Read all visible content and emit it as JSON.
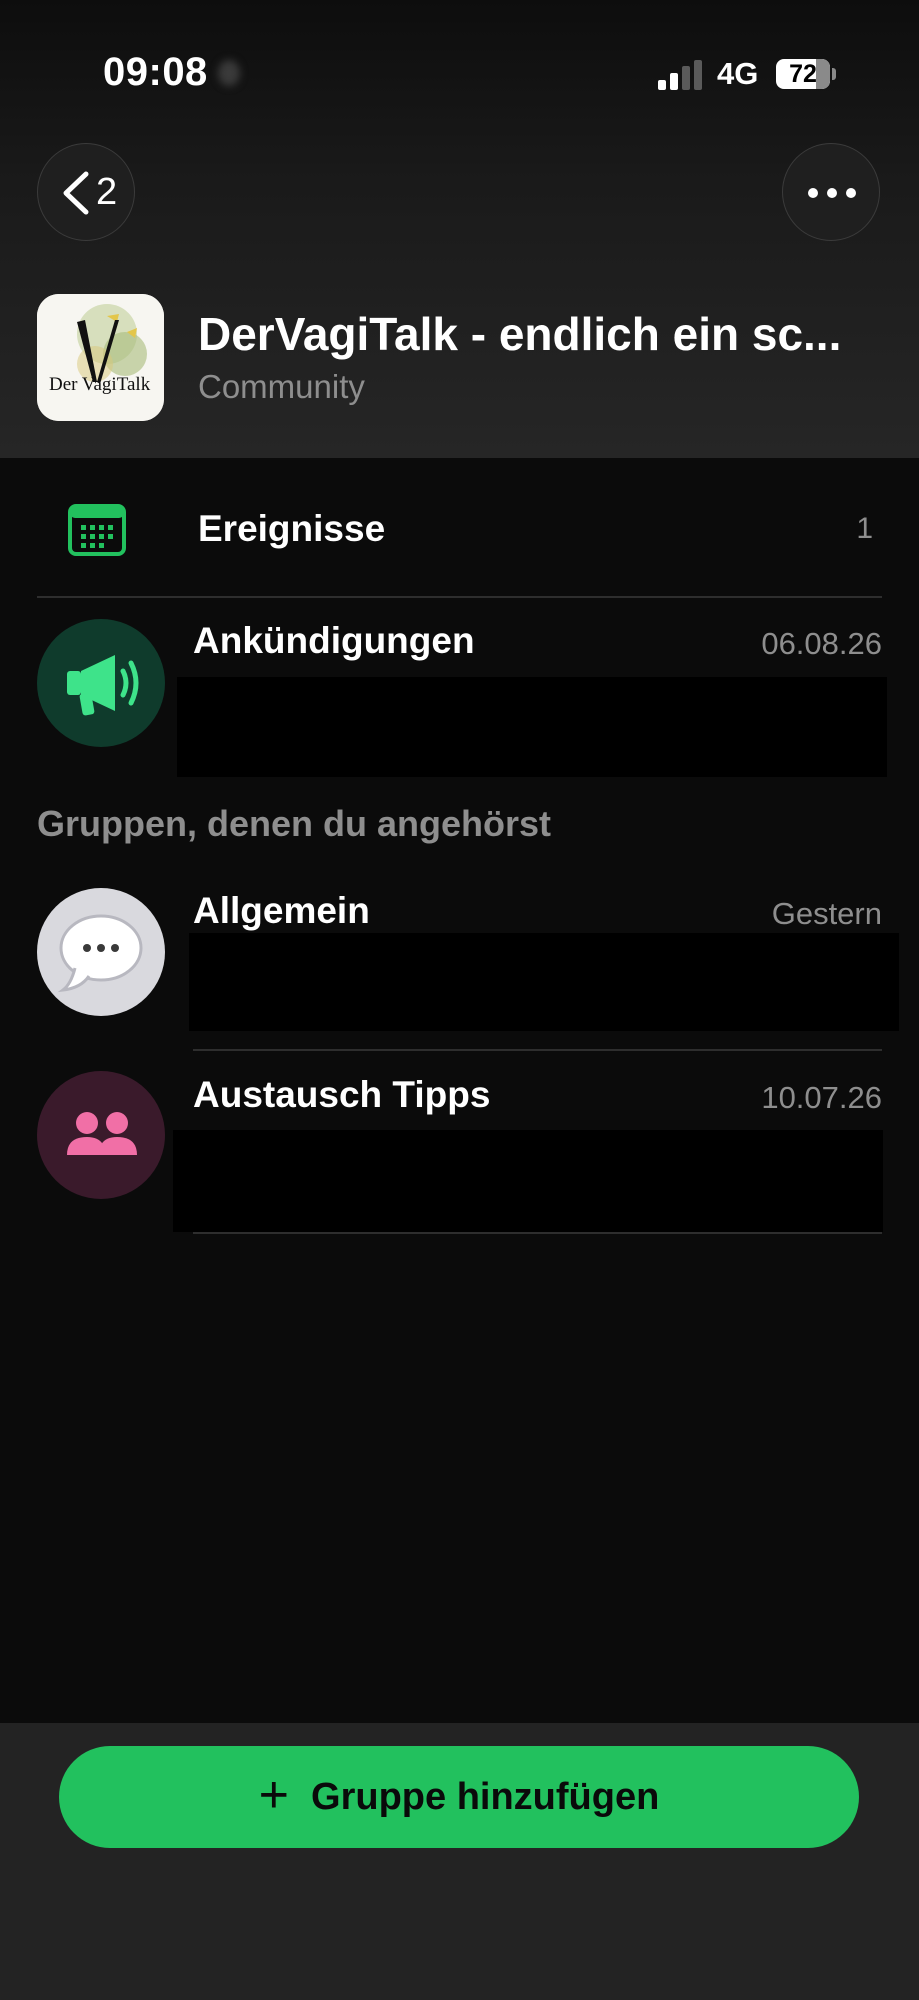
{
  "status_bar": {
    "time": "09:08",
    "network": "4G",
    "battery": "72"
  },
  "nav": {
    "back_count": "2"
  },
  "community": {
    "title": "DerVagiTalk - endlich ein sc...",
    "subtitle": "Community",
    "logo_text": "Der VagiTalk"
  },
  "events": {
    "label": "Ereignisse",
    "count": "1"
  },
  "announcements": {
    "name": "Ankündigungen",
    "time": "06.08.26"
  },
  "groups_section": {
    "label": "Gruppen, denen du angehörst"
  },
  "groups": [
    {
      "name": "Allgemein",
      "time": "Gestern"
    },
    {
      "name": "Austausch Tipps",
      "time": "10.07.26"
    }
  ],
  "add_group": {
    "label": "Gruppe hinzufügen"
  },
  "colors": {
    "accent_green": "#22c15e",
    "announcement_bg": "#0f3b2c",
    "group_pink": "#f16fa6",
    "group_pink_bg": "#3a1a2b"
  }
}
